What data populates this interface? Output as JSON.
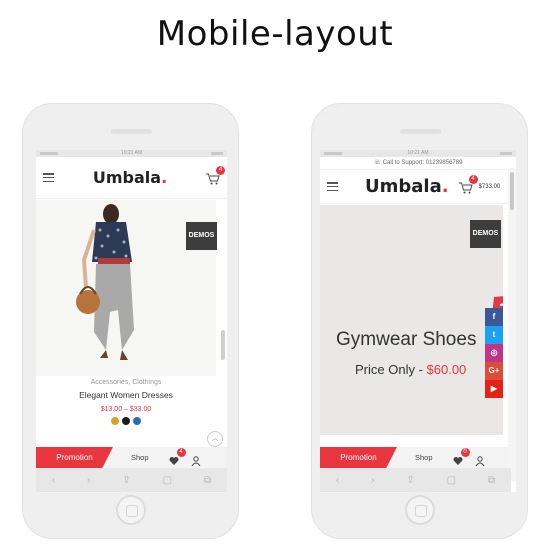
{
  "page": {
    "title": "Mobile-layout"
  },
  "left_phone": {
    "status_time": "10:21 AM",
    "logo": "Umbala",
    "logo_dot": ".",
    "cart_count": "4",
    "demos_label": "DEMOS",
    "product": {
      "category": "Accessories, Clothings",
      "name": "Elegant Women Dresses",
      "price": "$13.00 – $33.00",
      "swatches": [
        "#d4a326",
        "#1a1a1a",
        "#2a6db5"
      ]
    },
    "bottom_bar": {
      "promotion": "Promotion",
      "shop": "Shop",
      "wishlist_count": "4"
    }
  },
  "right_phone": {
    "status_time": "10:21 AM",
    "support_text": "Call to Support: 01239856789",
    "logo": "Umbala",
    "logo_dot": ".",
    "cart_count": "4",
    "cart_total": "$733.00",
    "demos_label": "DEMOS",
    "hero": {
      "title": "Gymwear Shoes",
      "price_label": "Price Only - ",
      "price_value": "$60.00"
    },
    "social": [
      {
        "icon": "f",
        "color": "#3b5998"
      },
      {
        "icon": "t",
        "color": "#1da1f2"
      },
      {
        "icon": "◎",
        "color": "#c13584"
      },
      {
        "icon": "G+",
        "color": "#dd4b39"
      },
      {
        "icon": "▶",
        "color": "#e62117"
      }
    ],
    "bottom_bar": {
      "promotion": "Promotion",
      "shop": "Shop",
      "wishlist_count": "0"
    }
  },
  "colors": {
    "accent": "#e8353e",
    "demos_bg": "#3d3d3d"
  }
}
